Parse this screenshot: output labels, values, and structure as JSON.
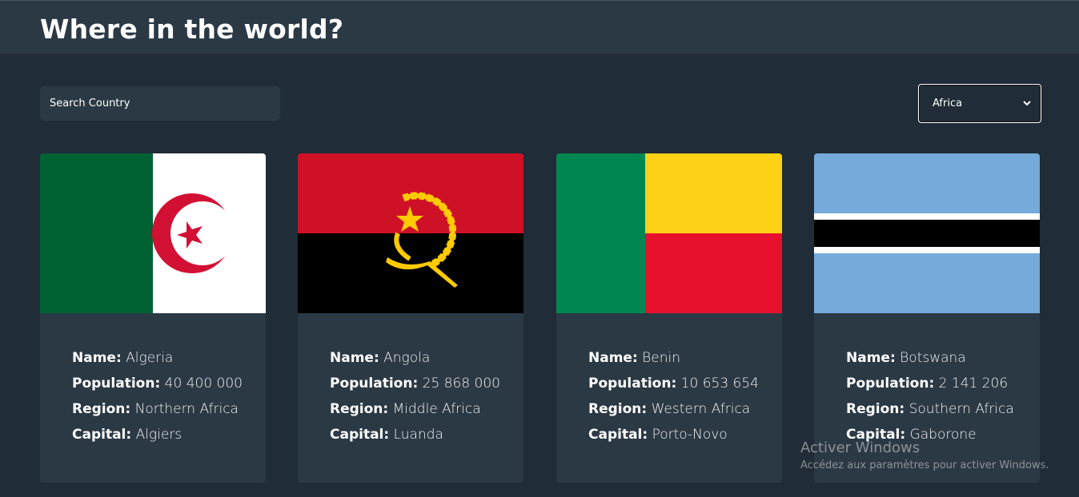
{
  "header": {
    "title": "Where in the world?"
  },
  "search": {
    "placeholder": "Search Country"
  },
  "filter": {
    "selected": "Africa"
  },
  "labels": {
    "name": "Name:",
    "population": "Population:",
    "region": "Region:",
    "capital": "Capital:"
  },
  "countries": [
    {
      "name": "Algeria",
      "population": "40 400 000",
      "region": "Northern Africa",
      "capital": "Algiers",
      "flag_icon": "algeria-flag"
    },
    {
      "name": "Angola",
      "population": "25 868 000",
      "region": "Middle Africa",
      "capital": "Luanda",
      "flag_icon": "angola-flag"
    },
    {
      "name": "Benin",
      "population": "10 653 654",
      "region": "Western Africa",
      "capital": "Porto-Novo",
      "flag_icon": "benin-flag"
    },
    {
      "name": "Botswana",
      "population": "2 141 206",
      "region": "Southern Africa",
      "capital": "Gaborone",
      "flag_icon": "botswana-flag"
    }
  ],
  "watermark": {
    "title": "Activer Windows",
    "subtitle": "Accédez aux paramètres pour activer Windows."
  },
  "colors": {
    "background": "#202c37",
    "element": "#2b3945",
    "text": "#ffffff"
  }
}
